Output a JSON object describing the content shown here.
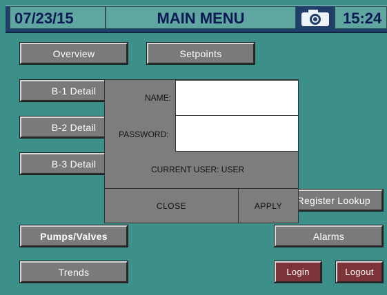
{
  "header": {
    "date": "07/23/15",
    "title": "MAIN MENU",
    "time": "15:24",
    "camera_icon": "camera-icon"
  },
  "buttons": {
    "overview": "Overview",
    "setpoints": "Setpoints",
    "b1_detail": "B-1 Detail",
    "b2_detail": "B-2 Detail",
    "b3_detail": "B-3 Detail",
    "register_lookup": "Register Lookup",
    "pumps_valves": "Pumps/Valves",
    "alarms": "Alarms",
    "trends": "Trends",
    "login": "Login",
    "logout": "Logout"
  },
  "login_dialog": {
    "name_label": "NAME:",
    "name_value": "",
    "password_label": "PASSWORD:",
    "password_value": "",
    "current_user": "CURRENT USER: USER",
    "close": "CLOSE",
    "apply": "APPLY"
  },
  "colors": {
    "background": "#3d8f8a",
    "header_bar": "#1f3f6a",
    "header_cell": "#5fa5a0",
    "button": "#7a7a7a",
    "login_button": "#7e3338"
  }
}
